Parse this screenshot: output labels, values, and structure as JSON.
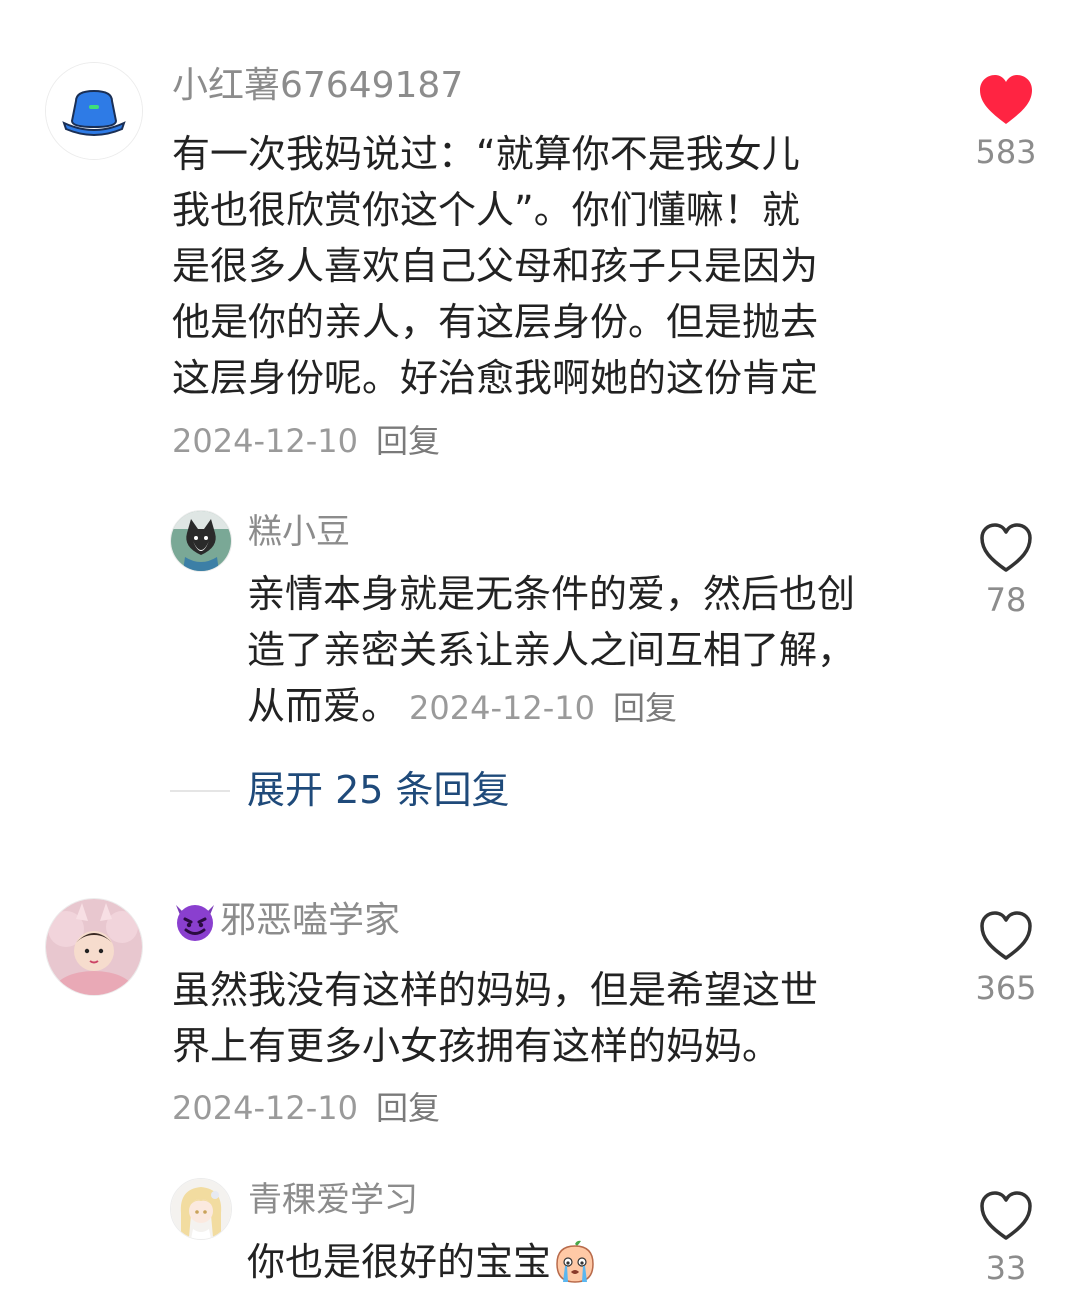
{
  "comments": [
    {
      "username": "小红薯67649187",
      "lines": [
        "有一次我妈说过：“就算你不是我女儿",
        "我也很欣赏你这个人”。你们懂嘛！就",
        "是很多人喜欢自己父母和孩子只是因为",
        "他是你的亲人，有这层身份。但是抛去",
        "这层身份呢。好治愈我啊她的这份肯定"
      ],
      "date": "2024-12-10",
      "reply_label": "回复",
      "likes": "583",
      "liked": true,
      "avatar": "bucket-hat-icon"
    },
    {
      "username": "糕小豆",
      "lines": [
        "亲情本身就是无条件的爱，然后也创",
        "造了亲密关系让亲人之间互相了解，",
        "从而爱。"
      ],
      "date": "2024-12-10",
      "reply_label": "回复",
      "likes": "78",
      "liked": false,
      "avatar": "shiba-dog-avatar"
    },
    {
      "username": "邪恶嗑学家",
      "lines": [
        "虽然我没有这样的妈妈，但是希望这世",
        "界上有更多小女孩拥有这样的妈妈。"
      ],
      "date": "2024-12-10",
      "reply_label": "回复",
      "likes": "365",
      "liked": false,
      "avatar": "girl-pink-avatar",
      "badge": "devil-emoji-icon"
    },
    {
      "username": "青稞爱学习",
      "lines": [
        "你也是很好的宝宝"
      ],
      "likes": "33",
      "liked": false,
      "avatar": "anime-girl-avatar",
      "trailing_emoji": "crying-peach-emoji-icon"
    }
  ],
  "expand_replies": "展开 25 条回复",
  "colors": {
    "liked_heart": "#ff2442",
    "link": "#1f4a7a",
    "muted": "#8c8c8c"
  }
}
